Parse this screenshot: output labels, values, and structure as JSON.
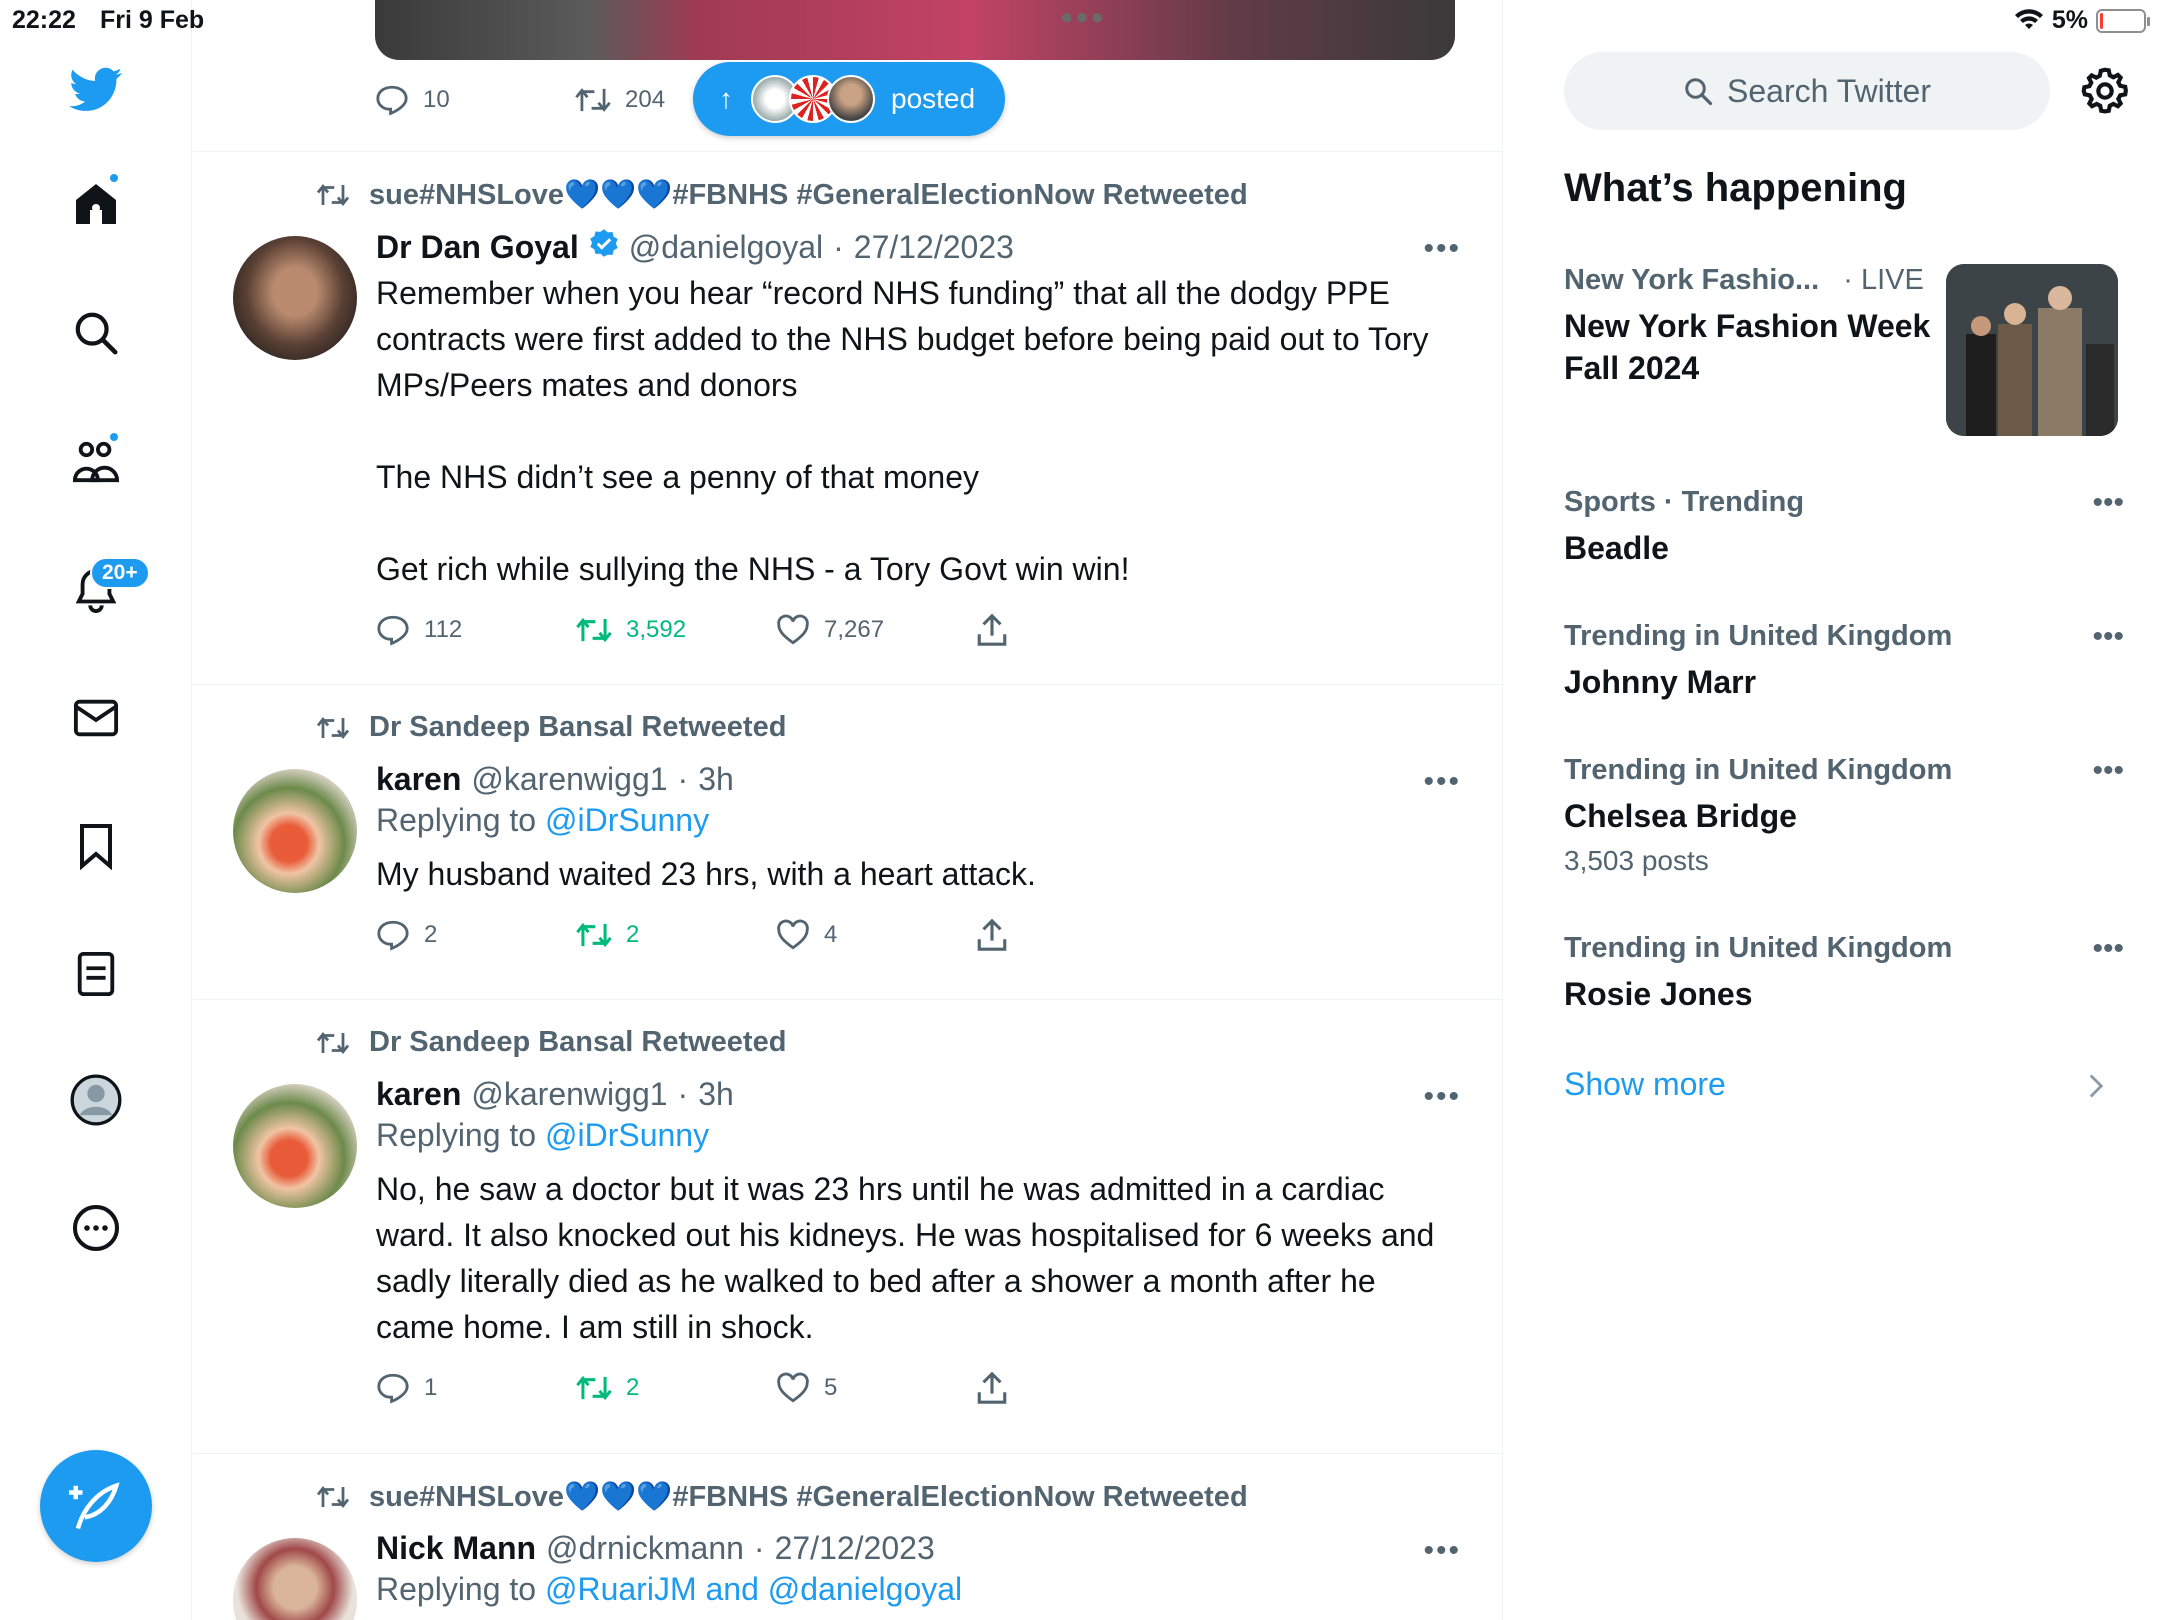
{
  "status": {
    "time": "22:22",
    "date": "Fri 9 Feb",
    "battery_percent": "5%",
    "battery_level": 0.05
  },
  "nav": {
    "notifications_badge": "20+",
    "icons": [
      "twitter-logo-icon",
      "home-icon",
      "search-icon",
      "communities-icon",
      "notifications-icon",
      "messages-icon",
      "bookmarks-icon",
      "lists-icon",
      "profile-icon",
      "more-icon",
      "compose-icon"
    ]
  },
  "feed": {
    "top_tweet": {
      "replies": "10",
      "retweets": "204"
    },
    "posted_pill": {
      "label": "posted"
    },
    "tweets": [
      {
        "retweeted_by": "sue#NHSLove💙💙💙#FBNHS #GeneralElectionNow Retweeted",
        "name": "Dr Dan Goyal",
        "handle": "@danielgoyal",
        "date": "27/12/2023",
        "verified": true,
        "text": "Remember when you hear “record NHS funding” that all the dodgy PPE contracts were first added to the NHS budget before being paid out to Tory MPs/Peers mates and donors\n\nThe NHS didn’t see a penny of that money\n\nGet rich while sullying the NHS - a Tory Govt win win!",
        "replies": "112",
        "retweets": "3,592",
        "likes": "7,267"
      },
      {
        "retweeted_by": "Dr Sandeep Bansal Retweeted",
        "name": "karen",
        "handle": "@karenwigg1",
        "date": "3h",
        "replying_prefix": "Replying to",
        "replying_to": "@iDrSunny",
        "text": "My husband waited 23 hrs, with a heart attack.",
        "replies": "2",
        "retweets": "2",
        "likes": "4"
      },
      {
        "retweeted_by": "Dr Sandeep Bansal Retweeted",
        "name": "karen",
        "handle": "@karenwigg1",
        "date": "3h",
        "replying_prefix": "Replying to",
        "replying_to": "@iDrSunny",
        "text": "No, he saw a doctor but it was 23 hrs until he was admitted in a cardiac ward. It also knocked out his kidneys. He was hospitalised for 6 weeks and sadly literally died as he walked to bed after a shower a month after he came home. I am still in shock.",
        "replies": "1",
        "retweets": "2",
        "likes": "5"
      },
      {
        "retweeted_by": "sue#NHSLove💙💙💙#FBNHS #GeneralElectionNow Retweeted",
        "name": "Nick Mann",
        "handle": "@drnickmann",
        "date": "27/12/2023",
        "replying_prefix": "Replying to",
        "replying_to": "@RuariJM and @danielgoyal"
      }
    ]
  },
  "sidebar": {
    "search_placeholder": "Search Twitter",
    "whats_happening": "What’s happening",
    "trends": [
      {
        "meta": "New York Fashio...",
        "meta_suffix": "· LIVE",
        "name": "New York Fashion Week Fall 2024",
        "has_image": true
      },
      {
        "meta": "Sports · Trending",
        "name": "Beadle"
      },
      {
        "meta": "Trending in United Kingdom",
        "name": "Johnny Marr"
      },
      {
        "meta": "Trending in United Kingdom",
        "name": "Chelsea Bridge",
        "posts": "3,503 posts"
      },
      {
        "meta": "Trending in United Kingdom",
        "name": "Rosie Jones"
      }
    ],
    "show_more": "Show more"
  },
  "colors": {
    "accent": "#1d9bf0",
    "retweet_green": "#00ba7c",
    "secondary_text": "#536471"
  }
}
